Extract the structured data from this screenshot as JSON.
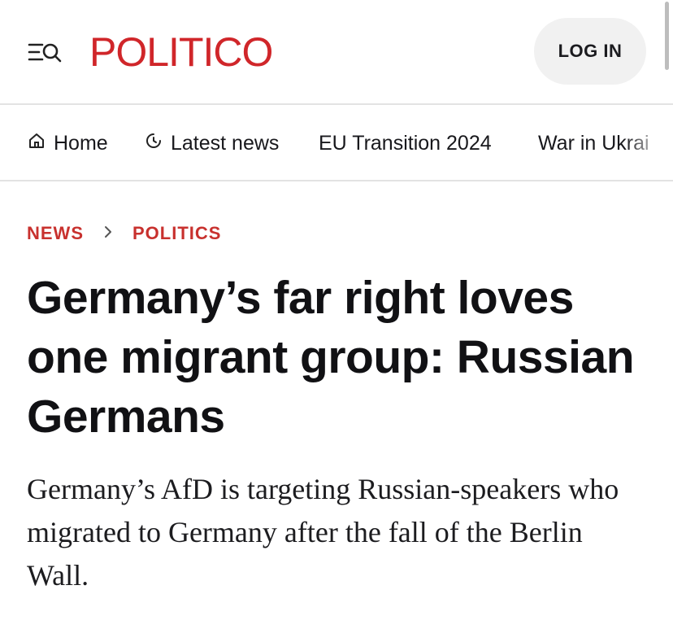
{
  "header": {
    "menu_icon": "menu-search-icon",
    "logo_text": "POLITICO",
    "login_label": "LOG IN",
    "colors": {
      "brand": "#d0262a",
      "login_bg": "#f1f1f1"
    }
  },
  "nav": {
    "items": [
      {
        "label": "Home",
        "icon": "home-icon"
      },
      {
        "label": "Latest news",
        "icon": "clock-icon"
      },
      {
        "label": "EU Transition 2024"
      },
      {
        "label": "War in Ukrai"
      }
    ]
  },
  "breadcrumb": {
    "items": [
      {
        "label": "NEWS"
      },
      {
        "label": "POLITICS"
      }
    ],
    "separator_icon": "chevron-right-icon",
    "color": "#c8312e"
  },
  "article": {
    "headline": "Germany’s far right loves one migrant group: Russian Germans",
    "dek": "Germany’s AfD is targeting Russian-speakers who migrated to Germany after the fall of the Berlin Wall."
  }
}
